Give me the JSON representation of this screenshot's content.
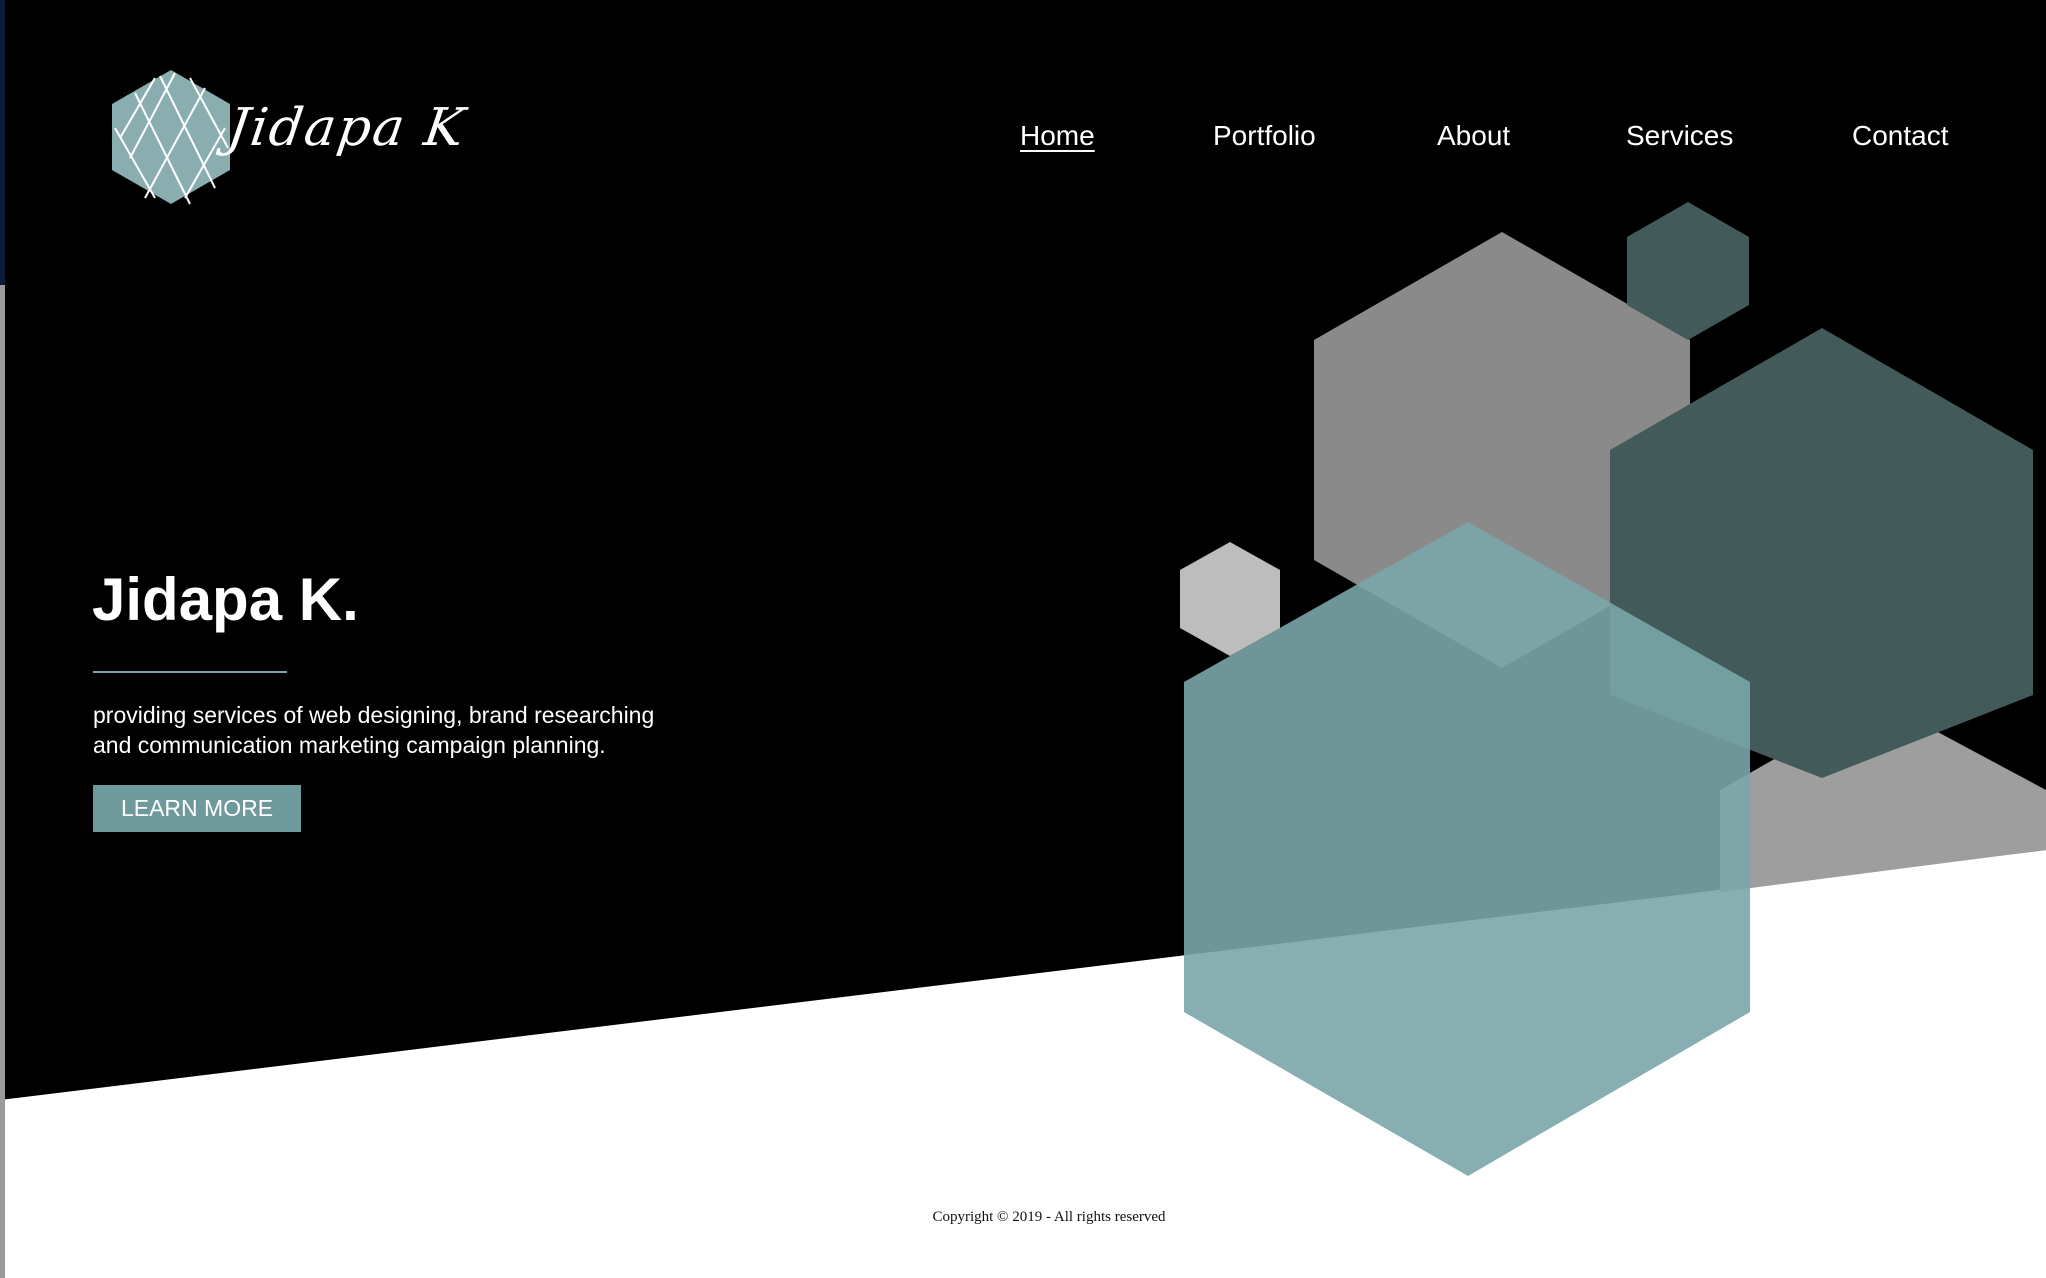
{
  "brand": {
    "logo_text": "Jidapa K",
    "logo_icon": "hexagon-lattice-icon"
  },
  "nav": {
    "items": [
      {
        "label": "Home",
        "active": true
      },
      {
        "label": "Portfolio",
        "active": false
      },
      {
        "label": "About",
        "active": false
      },
      {
        "label": "Services",
        "active": false
      },
      {
        "label": "Contact",
        "active": false
      }
    ]
  },
  "hero": {
    "title": "Jidapa K.",
    "subtitle_line1": "providing services of web designing, brand researching",
    "subtitle_line2": "and communication marketing campaign planning.",
    "cta_label": "LEARN MORE"
  },
  "footer": {
    "copyright": "Copyright © 2019 - All rights reserved"
  },
  "colors": {
    "background_dark": "#000000",
    "background_light": "#ffffff",
    "accent_teal": "#6f9a9b",
    "hex_gray": "#8a8a8a",
    "hex_dark_teal": "#425a5a",
    "hex_light_gray": "#bdbdbd",
    "hex_teal_translucent": "#7aa6a8"
  }
}
